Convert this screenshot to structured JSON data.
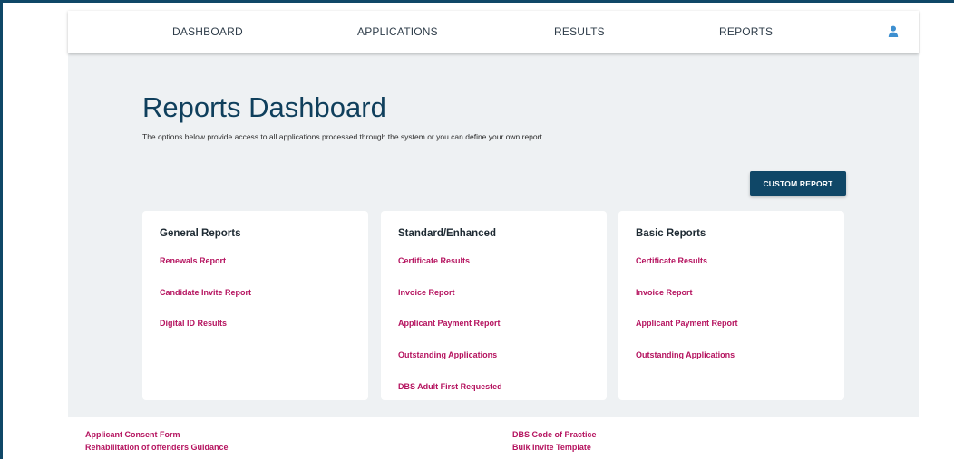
{
  "nav": {
    "items": [
      "DASHBOARD",
      "APPLICATIONS",
      "RESULTS",
      "REPORTS"
    ],
    "user_icon": "user-icon"
  },
  "page": {
    "title": "Reports Dashboard",
    "subtitle": "The options below provide access to all applications processed through the system or you can define your own report",
    "custom_report_label": "CUSTOM REPORT"
  },
  "cards": [
    {
      "title": "General Reports",
      "links": [
        "Renewals Report",
        "Candidate Invite Report",
        "Digital ID Results"
      ]
    },
    {
      "title": "Standard/Enhanced",
      "links": [
        "Certificate Results",
        "Invoice Report",
        "Applicant Payment Report",
        "Outstanding Applications",
        "DBS Adult First Requested"
      ]
    },
    {
      "title": "Basic Reports",
      "links": [
        "Certificate Results",
        "Invoice Report",
        "Applicant Payment Report",
        "Outstanding Applications"
      ]
    }
  ],
  "footer": {
    "left": [
      "Applicant Consent Form",
      "Rehabilitation of offenders Guidance"
    ],
    "right": [
      "DBS Code of Practice",
      "Bulk Invite Template"
    ]
  },
  "colors": {
    "accent": "#0f4767",
    "link": "#b5135f",
    "panel": "#eef1f3",
    "user_icon": "#3d8fd0"
  }
}
